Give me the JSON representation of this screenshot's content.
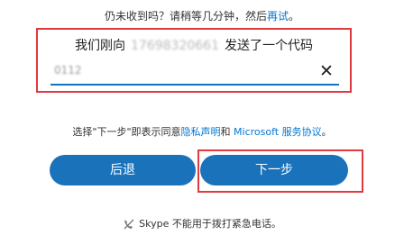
{
  "resend": {
    "prefix": "仍未收到吗？请稍等几分钟，然后",
    "link": "再试",
    "suffix": "。"
  },
  "verification": {
    "sent_prefix": "我们刚向",
    "phone_masked": "17698320661",
    "sent_suffix": "发送了一个代码",
    "code_value": "0112",
    "clear_icon": "close-icon"
  },
  "consent": {
    "prefix": "选择\"下一步\"即表示同意",
    "privacy_link": "隐私声明",
    "and": "和",
    "ms_link": "Microsoft 服务协议",
    "suffix": "。"
  },
  "buttons": {
    "back": "后退",
    "next": "下一步"
  },
  "footer": {
    "icon": "no-phone-icon",
    "text": "Skype 不能用于拨打紧急电话。"
  },
  "colors": {
    "accent": "#1a72bb",
    "highlight_border": "#e0393e",
    "link": "#0078d4"
  }
}
